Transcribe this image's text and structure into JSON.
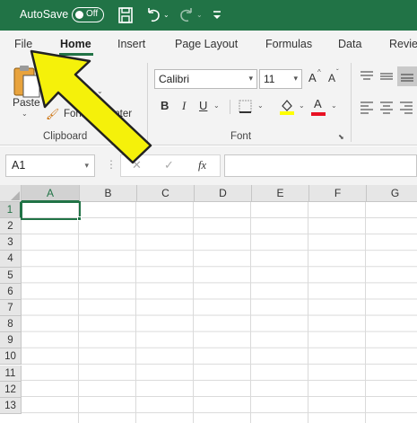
{
  "titlebar": {
    "autosave_label": "AutoSave",
    "autosave_state": "Off",
    "save_icon": "save-icon",
    "undo_icon": "undo-icon",
    "redo_icon": "redo-icon",
    "customize_icon": "customize-quick-access-icon",
    "bg_color": "#217346"
  },
  "tabs": {
    "items": [
      "File",
      "Home",
      "Insert",
      "Page Layout",
      "Formulas",
      "Data",
      "Revie"
    ],
    "active": "Home"
  },
  "ribbon": {
    "clipboard": {
      "paste_label": "Paste",
      "copy_label": "Co",
      "format_painter_label": "Format Painter",
      "group_label": "Clipboard"
    },
    "font": {
      "font_name": "Calibri",
      "font_size": "11",
      "bold": "B",
      "italic": "I",
      "underline": "U",
      "grow_font": "A",
      "shrink_font": "A",
      "font_color_letter": "A",
      "group_label": "Font"
    }
  },
  "formula_bar": {
    "name_box": "A1",
    "fx_label": "fx",
    "cancel_symbol": "✕",
    "enter_symbol": "✓",
    "formula_value": ""
  },
  "grid": {
    "columns": [
      "A",
      "B",
      "C",
      "D",
      "E",
      "F",
      "G"
    ],
    "rows": [
      "1",
      "2",
      "3",
      "4",
      "5",
      "6",
      "7",
      "8",
      "9",
      "10",
      "11",
      "12",
      "13"
    ],
    "selected_cell": "A1",
    "accent_color": "#217346"
  },
  "annotation": {
    "arrow_color": "#f5f10a",
    "points_to": "File"
  }
}
